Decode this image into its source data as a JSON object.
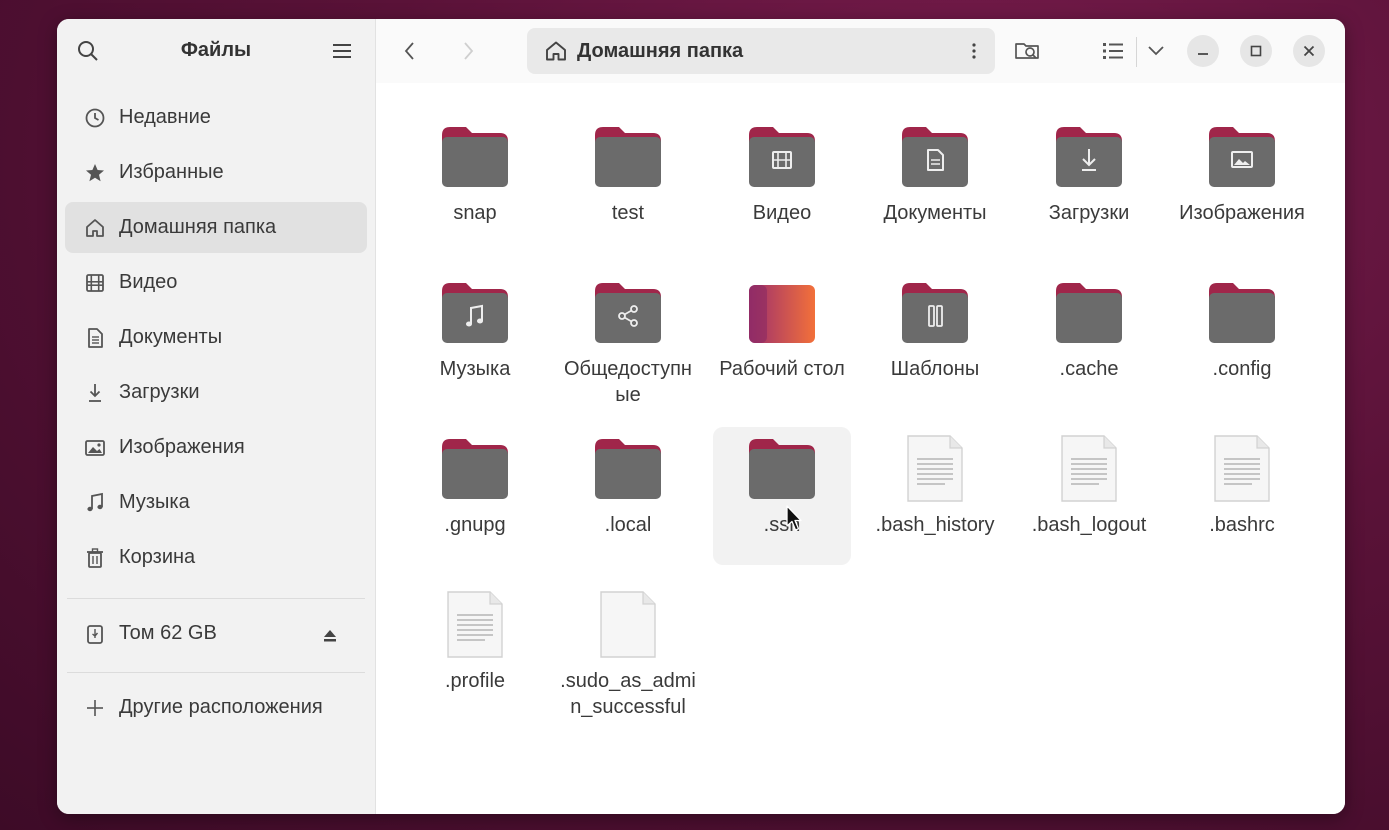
{
  "app": {
    "title": "Файлы"
  },
  "sidebar": {
    "items": [
      {
        "label": "Недавние",
        "icon": "clock-icon"
      },
      {
        "label": "Избранные",
        "icon": "star-icon"
      },
      {
        "label": "Домашняя папка",
        "icon": "home-icon",
        "active": true
      },
      {
        "label": "Видео",
        "icon": "film-icon"
      },
      {
        "label": "Документы",
        "icon": "document-icon"
      },
      {
        "label": "Загрузки",
        "icon": "download-icon"
      },
      {
        "label": "Изображения",
        "icon": "image-icon"
      },
      {
        "label": "Музыка",
        "icon": "music-icon"
      },
      {
        "label": "Корзина",
        "icon": "trash-icon"
      }
    ],
    "volume": {
      "label": "Том 62 GB",
      "icon": "usb-drive-icon"
    },
    "other": {
      "label": "Другие расположения",
      "icon": "plus-icon"
    }
  },
  "header": {
    "path": "Домашняя папка"
  },
  "files": [
    {
      "name": "snap",
      "type": "folder"
    },
    {
      "name": "test",
      "type": "folder"
    },
    {
      "name": "Видео",
      "type": "folder-video"
    },
    {
      "name": "Документы",
      "type": "folder-documents"
    },
    {
      "name": "Загрузки",
      "type": "folder-downloads"
    },
    {
      "name": "Изображения",
      "type": "folder-pictures"
    },
    {
      "name": "Музыка",
      "type": "folder-music"
    },
    {
      "name": "Общедоступные",
      "type": "folder-public"
    },
    {
      "name": "Рабочий стол",
      "type": "folder-desktop"
    },
    {
      "name": "Шаблоны",
      "type": "folder-templates"
    },
    {
      "name": ".cache",
      "type": "folder"
    },
    {
      "name": ".config",
      "type": "folder"
    },
    {
      "name": ".gnupg",
      "type": "folder"
    },
    {
      "name": ".local",
      "type": "folder"
    },
    {
      "name": ".ssh",
      "type": "folder",
      "hovered": true
    },
    {
      "name": ".bash_history",
      "type": "text-file"
    },
    {
      "name": ".bash_logout",
      "type": "text-file"
    },
    {
      "name": ".bashrc",
      "type": "text-file"
    },
    {
      "name": ".profile",
      "type": "text-file"
    },
    {
      "name": ".sudo_as_admin_successful",
      "type": "empty-file"
    }
  ],
  "colors": {
    "folder_tab": "#a0264a",
    "folder_body": "#6b6b6b",
    "desktop_grad_start": "#9c2f6e",
    "desktop_grad_end": "#f2703a"
  }
}
